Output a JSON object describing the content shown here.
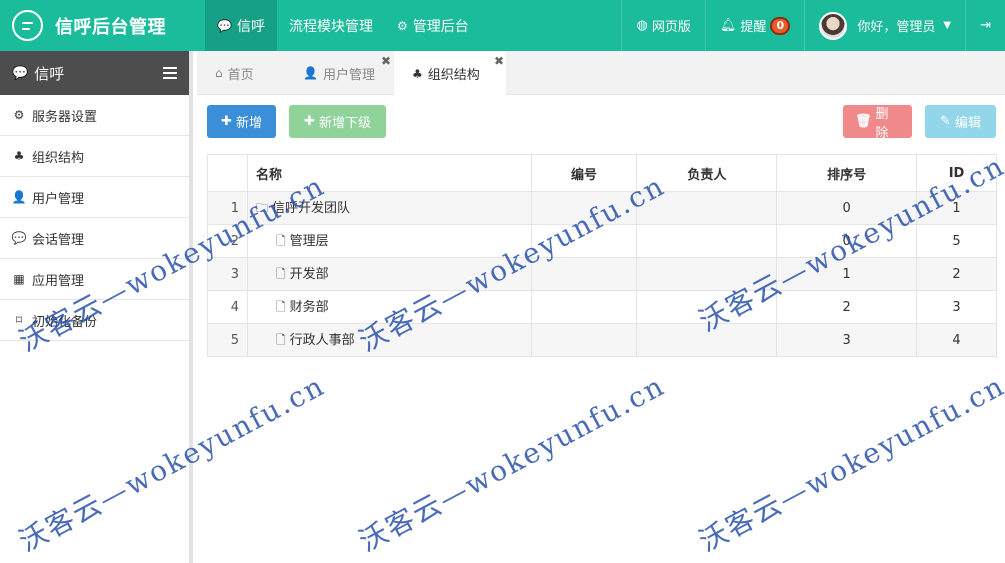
{
  "app": {
    "title": "信呼后台管理"
  },
  "topnav": {
    "items": [
      {
        "icon": "comment-icon",
        "glyph": "💬",
        "label": "信呼",
        "active": true
      },
      {
        "icon": "",
        "glyph": "",
        "label": "流程模块管理",
        "active": false
      },
      {
        "icon": "gear-icon",
        "glyph": "⚙",
        "label": "管理后台",
        "active": false
      }
    ]
  },
  "topright": {
    "web_label": "网页版",
    "remind_label": "提醒",
    "remind_count": "0",
    "user_greeting": "你好，管理员"
  },
  "sidebar": {
    "header": "信呼",
    "items": [
      {
        "icon": "gear-icon",
        "glyph": "⚙",
        "label": "服务器设置"
      },
      {
        "icon": "sitemap-icon",
        "glyph": "♣",
        "label": "组织结构"
      },
      {
        "icon": "user-icon",
        "glyph": "👤",
        "label": "用户管理"
      },
      {
        "icon": "comments-icon",
        "glyph": "💬",
        "label": "会话管理"
      },
      {
        "icon": "grid-icon",
        "glyph": "▦",
        "label": "应用管理"
      },
      {
        "icon": "bookmark-icon",
        "glyph": "⌑",
        "label": "初始化备份"
      }
    ]
  },
  "tabs": [
    {
      "icon": "home-icon",
      "glyph": "⌂",
      "label": "首页",
      "active": false,
      "closable": false
    },
    {
      "icon": "user-icon",
      "glyph": "👤",
      "label": "用户管理",
      "active": false,
      "closable": true
    },
    {
      "icon": "sitemap-icon",
      "glyph": "♣",
      "label": "组织结构",
      "active": true,
      "closable": true
    }
  ],
  "toolbar": {
    "add_label": "新增",
    "add_sub_label": "新增下级",
    "delete_label": "删除",
    "edit_label": "编辑"
  },
  "table": {
    "headers": {
      "name": "名称",
      "code": "编号",
      "owner": "负责人",
      "sort": "排序号",
      "id": "ID"
    },
    "rows": [
      {
        "index": "1",
        "name": "信呼开发团队",
        "type": "folder",
        "code": "",
        "owner": "",
        "sort": "0",
        "id": "1"
      },
      {
        "index": "2",
        "name": "管理层",
        "type": "file",
        "code": "",
        "owner": "",
        "sort": "0",
        "id": "5"
      },
      {
        "index": "3",
        "name": "开发部",
        "type": "file",
        "code": "",
        "owner": "",
        "sort": "1",
        "id": "2"
      },
      {
        "index": "4",
        "name": "财务部",
        "type": "file",
        "code": "",
        "owner": "",
        "sort": "2",
        "id": "3"
      },
      {
        "index": "5",
        "name": "行政人事部",
        "type": "file",
        "code": "",
        "owner": "",
        "sort": "3",
        "id": "4"
      }
    ]
  },
  "watermark": {
    "text": "沃客云—wokeyunfu.cn"
  },
  "colors": {
    "topbar": "#1abc9c",
    "sidebar_header": "#4d4d4d",
    "btn_add": "#3a8fd8",
    "btn_add_sub": "#8fd39a",
    "btn_delete": "#f0898a",
    "btn_edit": "#93d6ea"
  }
}
